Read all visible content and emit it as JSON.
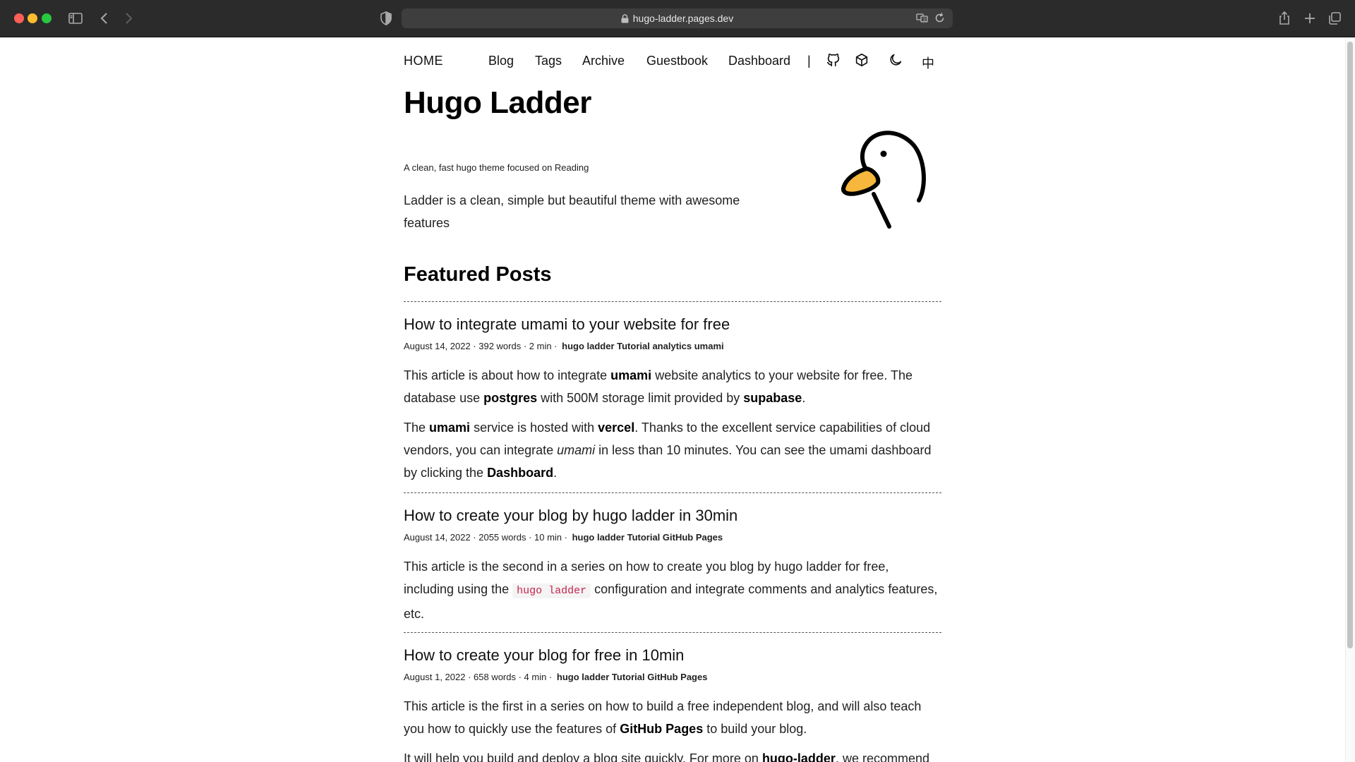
{
  "browser": {
    "url": "hugo-ladder.pages.dev"
  },
  "nav": {
    "home": "HOME",
    "links": [
      "Blog",
      "Tags",
      "Archive",
      "Guestbook",
      "Dashboard"
    ],
    "separator": "|",
    "icons": [
      "github-icon",
      "cube-icon",
      "moon-icon"
    ],
    "lang": "中"
  },
  "hero": {
    "title": "Hugo Ladder",
    "subtitle": "A clean, fast hugo theme focused on Reading",
    "description": "Ladder is a clean, simple but beautiful theme with awesome features"
  },
  "featured": {
    "heading": "Featured Posts",
    "posts": [
      {
        "title": "How to integrate umami to your website for free",
        "meta": "August 14, 2022 · 392 words · 2 min ·",
        "tags": "hugo ladder Tutorial analytics umami",
        "p1": {
          "a": "This article is about how to integrate ",
          "b": "umami",
          "c": " website analytics to your website for free. The database use ",
          "d": "postgres",
          "e": " with 500M storage limit provided by ",
          "f": "supabase",
          "g": "."
        },
        "p2": {
          "a": "The ",
          "b": "umami",
          "c": " service is hosted with ",
          "d": "vercel",
          "e": ". Thanks to the excellent service capabilities of cloud vendors, you can integrate ",
          "f": "umami",
          "g": " in less than 10 minutes. You can see the umami dashboard by clicking the ",
          "h": "Dashboard",
          "i": "."
        }
      },
      {
        "title": "How to create your blog by hugo ladder in 30min",
        "meta": "August 14, 2022 · 2055 words · 10 min ·",
        "tags": "hugo ladder Tutorial GitHub Pages",
        "p1": {
          "a": "This article is the second in a series on how to create you blog by hugo ladder for free, including using the ",
          "code": "hugo ladder",
          "b": " configuration and integrate comments and analytics features, etc."
        }
      },
      {
        "title": "How to create your blog for free in 10min",
        "meta": "August 1, 2022 · 658 words · 4 min ·",
        "tags": "hugo ladder Tutorial GitHub Pages",
        "p1": {
          "a": "This article is the first in a series on how to build a free independent blog, and will also teach you how to quickly use the features of ",
          "b": "GitHub Pages",
          "c": " to build your blog."
        },
        "p2": {
          "a": "It will help you build and deploy a blog site quickly. For more on ",
          "b": "hugo-ladder",
          "c": ", we recommend"
        }
      }
    ]
  },
  "colors": {
    "chrome_bg": "#2b2b2b",
    "urlbar_bg": "#3e3e3e",
    "code_text": "#c7254e",
    "duck_beak": "#f6b73c"
  }
}
